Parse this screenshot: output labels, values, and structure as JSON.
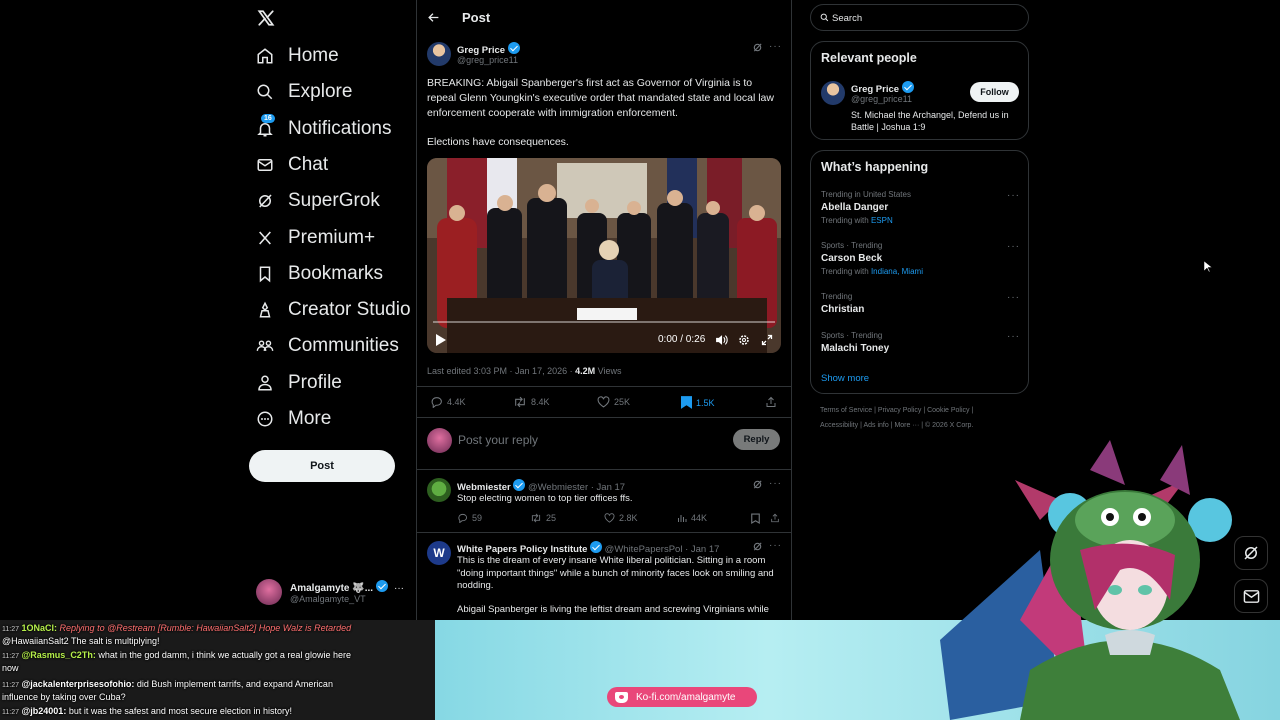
{
  "nav": {
    "items": [
      {
        "label": "Home",
        "icon": "home-icon"
      },
      {
        "label": "Explore",
        "icon": "search-icon"
      },
      {
        "label": "Notifications",
        "icon": "bell-icon",
        "badge": "16"
      },
      {
        "label": "Chat",
        "icon": "mail-icon"
      },
      {
        "label": "SuperGrok",
        "icon": "grok-icon"
      },
      {
        "label": "Premium+",
        "icon": "x-logo-icon"
      },
      {
        "label": "Bookmarks",
        "icon": "bookmark-icon"
      },
      {
        "label": "Creator Studio",
        "icon": "creator-icon"
      },
      {
        "label": "Communities",
        "icon": "communities-icon"
      },
      {
        "label": "Profile",
        "icon": "person-icon"
      },
      {
        "label": "More",
        "icon": "more-circle-icon"
      }
    ],
    "post_button": "Post",
    "account": {
      "name": "Amalgamyte 🐺...",
      "handle": "@Amalgamyte_VT"
    }
  },
  "header": {
    "title": "Post"
  },
  "post": {
    "author": "Greg Price",
    "handle": "@greg_price11",
    "text1": "BREAKING: Abigail Spanberger's first act as Governor of Virginia is to repeal Glenn Youngkin's executive order that mandated state and local law enforcement cooperate with immigration enforcement.",
    "text2": "Elections have consequences.",
    "video_time": "0:00 / 0:26",
    "video_progress": 0,
    "meta_prefix": "Last edited 3:03 PM · Jan 17, 2026 · ",
    "views": "4.2M",
    "views_label": " Views",
    "replies": "4.4K",
    "reposts": "8.4K",
    "likes": "25K",
    "bookmarks": "1.5K"
  },
  "reply_box": {
    "placeholder": "Post your reply",
    "button": "Reply"
  },
  "replies": [
    {
      "author": "Webmiester",
      "handle": "@Webmiester · Jan 17",
      "text": "Stop electing women to top tier offices ffs.",
      "replies": "59",
      "reposts": "25",
      "likes": "2.8K",
      "views": "44K"
    },
    {
      "author": "White Papers Policy Institute",
      "handle": "@WhitePapersPol · Jan 17",
      "text": "This is the dream of every insane White liberal politician.  Sitting in a room \"doing important things\" while a bunch of minority faces look on smiling and nodding.",
      "text2": "Abigail Spanberger is living the leftist dream and screwing Virginians while"
    }
  ],
  "search": {
    "placeholder": "Search"
  },
  "relevant": {
    "title": "Relevant people",
    "name": "Greg Price",
    "handle": "@greg_price11",
    "follow": "Follow",
    "bio": "St. Michael the Archangel, Defend us in Battle | Joshua 1:9"
  },
  "happening": {
    "title": "What’s happening",
    "trends": [
      {
        "meta": "Trending in United States",
        "title": "Abella Danger",
        "sub_prefix": "Trending with ",
        "sub_link": "ESPN"
      },
      {
        "meta": "Sports · Trending",
        "title": "Carson Beck",
        "sub_prefix": "Trending with ",
        "sub_link": "Indiana, Miami"
      },
      {
        "meta": "Trending",
        "title": "Christian",
        "sub_prefix": "",
        "sub_link": ""
      },
      {
        "meta": "Sports · Trending",
        "title": "Malachi Toney",
        "sub_prefix": "",
        "sub_link": ""
      }
    ],
    "show_more": "Show more"
  },
  "footer": {
    "line1": "Terms of Service  |  Privacy Policy  |  Cookie Policy  |",
    "line2": "Accessibility  |  Ads info  |  More ···  |  © 2026 X Corp."
  },
  "chat": [
    {
      "time": "11:27",
      "user": "1ONaCl:",
      "msg": "Replying to @Restream [Rumble: HawaiianSalt2] Hope Walz is Retarded",
      "cont": "@HawaiianSalt2 The salt is multiplying!"
    },
    {
      "time": "11:27",
      "user": "@Rasmus_C2Th:",
      "msg": "",
      "text": "what in the god damm, i think we actually got a real glowie here",
      "cont": "now"
    },
    {
      "time": "11:27",
      "user": "@jackalenterprisesofohio:",
      "msg": "",
      "text": "did Bush implement tarrifs, and expand American",
      "cont": "influence by taking over Cuba?"
    },
    {
      "time": "11:27",
      "user": "@jb24001:",
      "msg": "",
      "text": "but it was the safest and most secure election in history!",
      "cont": ""
    }
  ],
  "kofi": {
    "label": "Ko-fi.com/amalgamyte"
  },
  "colors": {
    "accent": "#1d9bf0",
    "bg": "#000000",
    "border": "#2f3336",
    "muted": "#71767b",
    "kofi": "#e9477a",
    "chat_bg": "#7ed3e0"
  }
}
